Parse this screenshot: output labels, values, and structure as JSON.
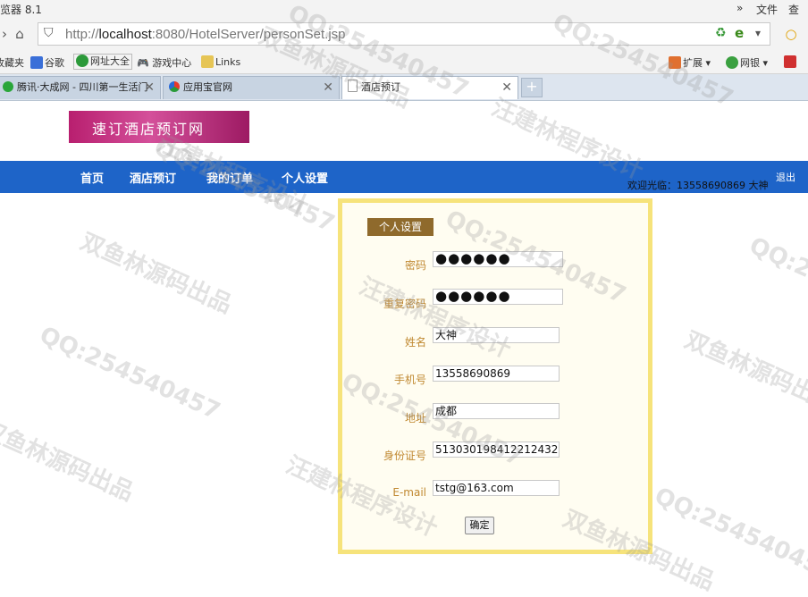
{
  "browser": {
    "title_fragment": "览器 8.1",
    "menu": {
      "more": "»",
      "file": "文件",
      "view": "查看"
    },
    "address": {
      "scheme": "http://",
      "host": "localhost",
      "rest": ":8080/HotelServer/personSet.jsp"
    },
    "bookmarks": [
      "收藏夹",
      "谷歌",
      "网址大全",
      "游戏中心",
      "Links"
    ],
    "right_tools": [
      "扩展",
      "网银"
    ],
    "tabs": [
      {
        "label": "腾讯·大成网 - 四川第一生活门",
        "active": false
      },
      {
        "label": "应用宝官网",
        "active": false
      },
      {
        "label": "酒店预订",
        "active": true
      }
    ]
  },
  "site": {
    "logo_text": "速订酒店预订网",
    "nav": [
      "首页",
      "酒店预订",
      "我的订单",
      "个人设置"
    ],
    "welcome": "欢迎光临：13558690869 大神",
    "logout": "退出"
  },
  "form": {
    "legend": "个人设置",
    "fields": [
      {
        "label": "密码",
        "value": "●●●●●●"
      },
      {
        "label": "重复密码",
        "value": "●●●●●●"
      },
      {
        "label": "姓名",
        "value": "大神"
      },
      {
        "label": "手机号",
        "value": "13558690869"
      },
      {
        "label": "地址",
        "value": "成都"
      },
      {
        "label": "身份证号",
        "value": "513030198412212432"
      },
      {
        "label": "E-mail",
        "value": "tstg@163.com"
      }
    ],
    "submit": "确定"
  },
  "watermarks": [
    "QQ:254540457",
    "双鱼林源码出品",
    "汪建林程序设计"
  ]
}
